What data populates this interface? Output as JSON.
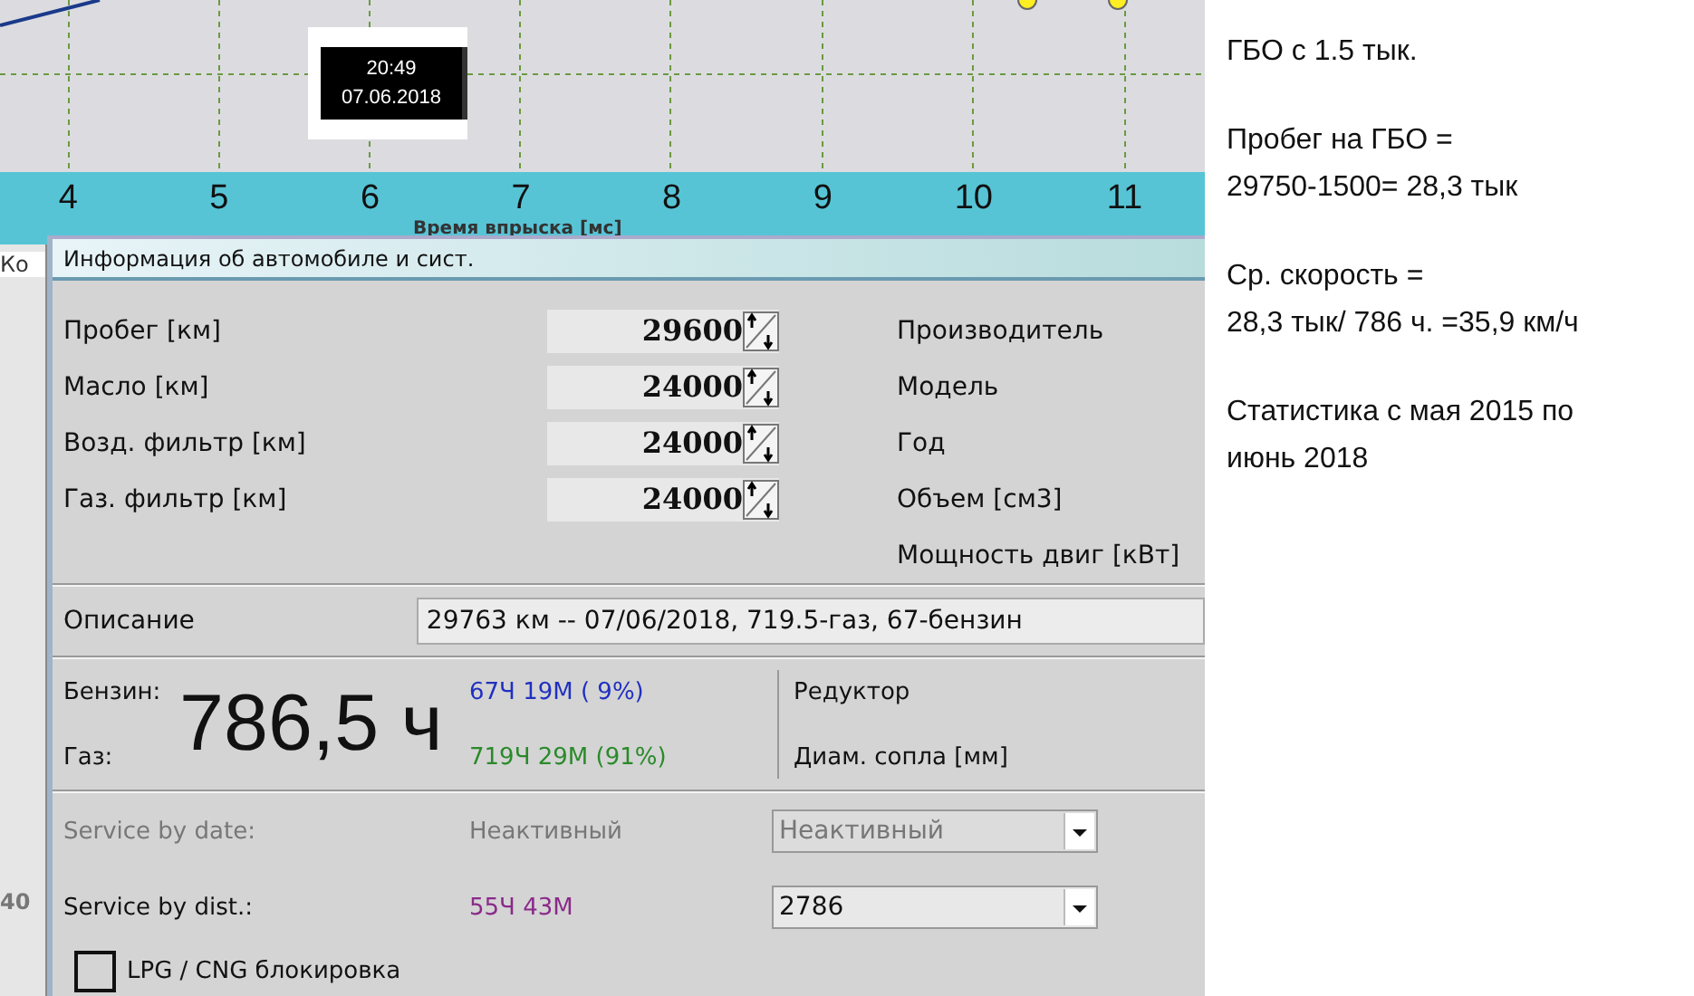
{
  "chart": {
    "x_ticks": [
      "4",
      "5",
      "6",
      "7",
      "8",
      "9",
      "10",
      "11"
    ],
    "x_label": "Время впрыска [мс]",
    "tooltip": {
      "time": "20:49",
      "date": "07.06.2018"
    }
  },
  "background_panel": {
    "tab": "Ко",
    "value": "40"
  },
  "dialog": {
    "title": "Информация об автомобиле и сист.",
    "counters": [
      {
        "label": "Пробег [км]",
        "value": "29600"
      },
      {
        "label": "Масло [км]",
        "value": "24000"
      },
      {
        "label": "Возд. фильтр [км]",
        "value": "24000"
      },
      {
        "label": "Газ. фильтр [км]",
        "value": "24000"
      }
    ],
    "car_fields": [
      "Производитель",
      "Модель",
      "Год",
      "Объем [см3]",
      "Мощность двиг [кВт]"
    ],
    "description": {
      "label": "Описание",
      "value": "29763 км -- 07/06/2018, 719.5-газ, 67-бензин"
    },
    "hours": {
      "petrol_label": "Бензин:",
      "gas_label": "Газ:",
      "total": "786,5 ч",
      "petrol_time": "67Ч 19М ( 9%)",
      "gas_time": "719Ч 29М (91%)"
    },
    "injector_fields": [
      "Редуктор",
      "Диам. сопла [мм]"
    ],
    "service": [
      {
        "label": "Service by date:",
        "status": "Неактивный",
        "select": "Неактивный",
        "disabled": true
      },
      {
        "label": "Service by dist.:",
        "status": "55Ч 43М",
        "select": "2786",
        "disabled": false
      }
    ],
    "lock": {
      "label": "LPG / CNG блокировка",
      "checked": false
    }
  },
  "notes": [
    {
      "lines": [
        "ГБО с 1.5 тык."
      ]
    },
    {
      "lines": [
        "Пробег на ГБО =",
        "29750-1500= 28,3 тык"
      ]
    },
    {
      "lines": [
        "Ср. скорость =",
        "28,3 тык/ 786 ч. =35,9 км/ч"
      ]
    },
    {
      "lines": [
        "Статистика с мая 2015 по",
        "июнь 2018"
      ]
    }
  ]
}
